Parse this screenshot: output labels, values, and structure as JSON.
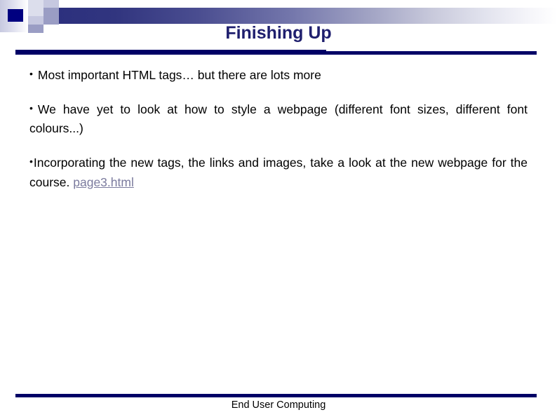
{
  "slide": {
    "title": "Finishing Up",
    "footer": "End User Computing",
    "accent_navy": "#000066",
    "title_color": "#1f1f6e",
    "link_color": "#7b7b9e",
    "band_start_color": "#2b2f7e",
    "band_end_color": "#ffffff"
  },
  "bullets": [
    {
      "marker": "•",
      "text": "Most important HTML tags… but there are lots more"
    },
    {
      "marker": "•",
      "text": "We have yet to look at how to style a webpage (different font sizes, different font colours...)"
    },
    {
      "marker": "•",
      "text_before_link": "Incorporating the new tags, the links and images, take a look at the new webpage for the course. ",
      "link_text": "page3.html"
    }
  ]
}
